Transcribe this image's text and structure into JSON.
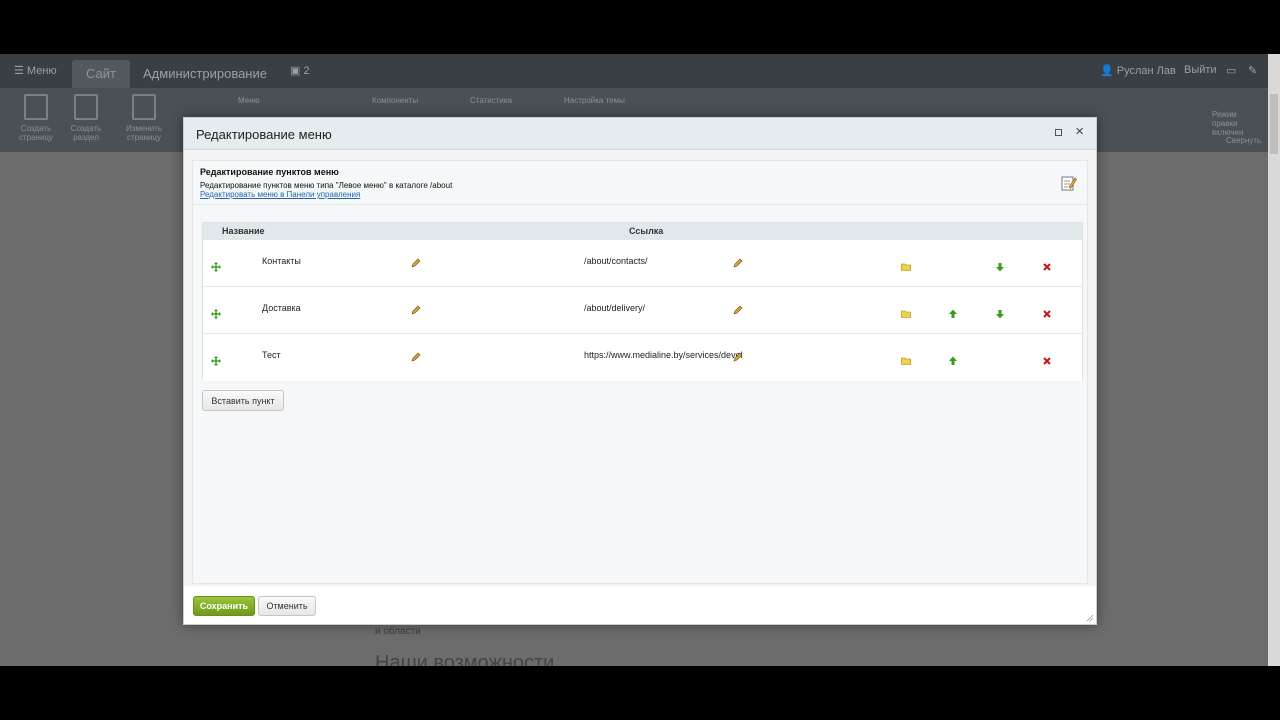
{
  "adminbar": {
    "menu_label": "Меню",
    "tab_site": "Сайт",
    "tab_admin": "Администрирование",
    "notif_count": "2",
    "user_name": "Руслан Лав",
    "logout": "Выйти"
  },
  "toolbar": {
    "create_page": "Создать страницу",
    "create_section": "Создать раздел",
    "edit_page": "Изменить страницу",
    "menu": "Меню",
    "components": "Компоненты",
    "statistics": "Статистика",
    "theme_settings": "Настройка темы",
    "edit_mode": "Режим правки включен",
    "collapse": "Свернуть"
  },
  "background": {
    "text1": "и области",
    "heading": "Наши возможности"
  },
  "modal": {
    "title": "Редактирование меню",
    "info_title": "Редактирование пунктов меню",
    "info_desc": "Редактирование пунктов меню типа \"Левое меню\" в каталоге /about",
    "info_link": "Редактировать меню в Панели управления",
    "col_name": "Название",
    "col_link": "Ссылка",
    "rows": [
      {
        "name": "Контакты",
        "link": "/about/contacts/"
      },
      {
        "name": "Доставка",
        "link": "/about/delivery/"
      },
      {
        "name": "Тест",
        "link": "https://www.medialine.by/services/develo"
      }
    ],
    "insert_button": "Вставить пункт",
    "save_button": "Сохранить",
    "cancel_button": "Отменить"
  },
  "colors": {
    "accent_green": "#7fab24",
    "link_blue": "#2067b0",
    "delete_red": "#cc1111",
    "folder_yellow": "#f0d24a",
    "arrow_green": "#3a9a1a"
  }
}
